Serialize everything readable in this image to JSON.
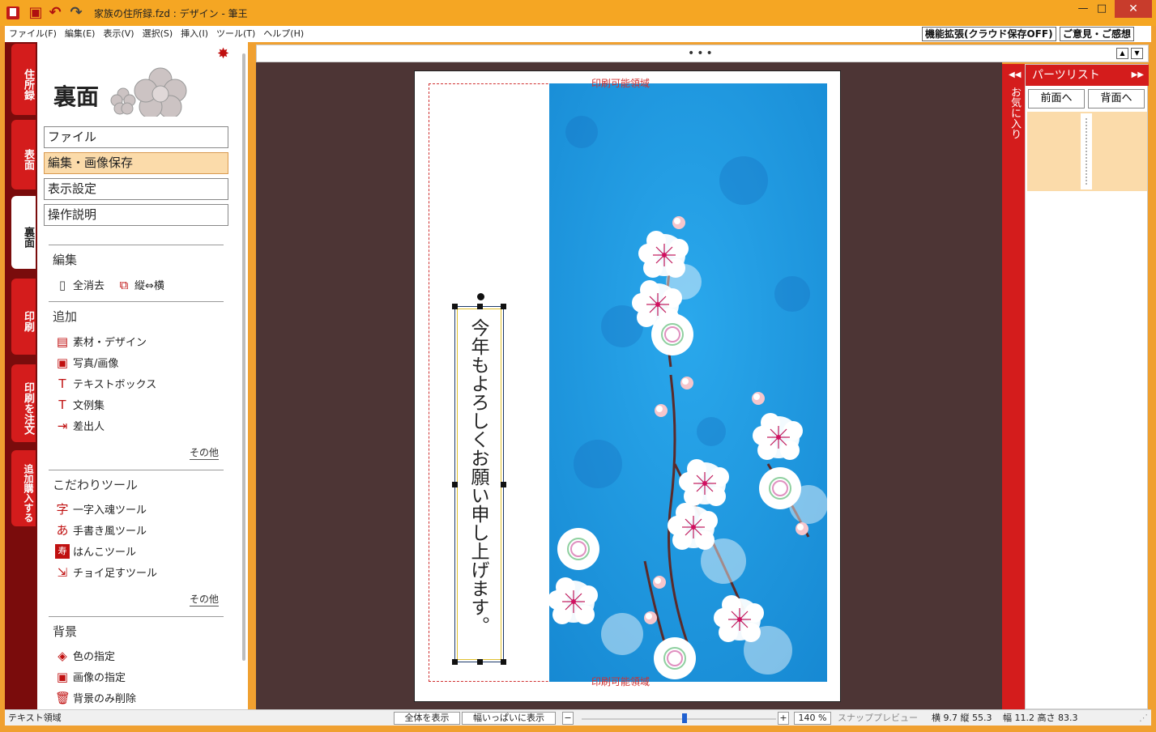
{
  "window": {
    "title": "家族の住所録.fzd : デザイン - 筆王"
  },
  "menu": {
    "items": [
      "ファイル(F)",
      "編集(E)",
      "表示(V)",
      "選択(S)",
      "挿入(I)",
      "ツール(T)",
      "ヘルプ(H)"
    ],
    "feature_ext": "機能拡張(クラウド保存OFF)",
    "feedback": "ご意見・ご感想"
  },
  "left_tabs": [
    "住所録",
    "表面",
    "裏面",
    "印刷",
    "印刷を注文",
    "追加購入する"
  ],
  "panel": {
    "title": "裏面",
    "buttons": [
      "ファイル",
      "編集・画像保存",
      "表示設定",
      "操作説明"
    ],
    "edit": {
      "heading": "編集",
      "clear_all": "全消去",
      "rotate": "縦⇔横"
    },
    "add": {
      "heading": "追加",
      "items": [
        "素材・デザイン",
        "写真/画像",
        "テキストボックス",
        "文例集",
        "差出人"
      ],
      "other": "その他"
    },
    "tools": {
      "heading": "こだわりツール",
      "items": [
        "一字入魂ツール",
        "手書き風ツール",
        "はんこツール",
        "チョイ足すツール"
      ],
      "other": "その他"
    },
    "background": {
      "heading": "背景",
      "items": [
        "色の指定",
        "画像の指定",
        "背景のみ削除"
      ]
    }
  },
  "canvas": {
    "print_area_label": "印刷可能領域",
    "greeting_text": "今年もよろしくお願い申し上げます。"
  },
  "favorites": {
    "label": "お気に入り"
  },
  "parts": {
    "title": "パーツリスト",
    "front_button": "前面へ",
    "back_button": "背面へ"
  },
  "status": {
    "mode": "テキスト領域",
    "show_all": "全体を表示",
    "fit_width": "幅いっぱいに表示",
    "zoom": "140 %",
    "snap": "スナップ",
    "preview": "プレビュー",
    "position": "横 9.7 縦 55.3",
    "size": "幅 11.2 高さ 83.3"
  },
  "colors": {
    "accent_red": "#d41c1c",
    "title_orange": "#f5a623",
    "canvas_bg": "#4d3535",
    "sky_blue": "#1a9ae0"
  }
}
